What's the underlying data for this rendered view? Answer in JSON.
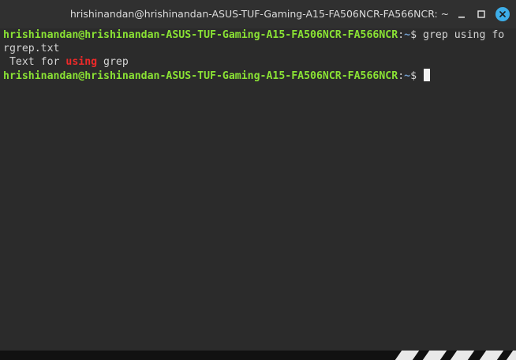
{
  "window": {
    "title": "hrishinandan@hrishinandan-ASUS-TUF-Gaming-A15-FA506NCR-FA566NCR: ~"
  },
  "terminal": {
    "line1": {
      "user_host": "hrishinandan@hrishinandan-ASUS-TUF-Gaming-A15-FA506NCR-FA566NCR",
      "sep": ":",
      "path": "~",
      "sym": "$ ",
      "cmd_part1": "grep using fo"
    },
    "line2": {
      "cmd_part2": "rgrep.txt"
    },
    "line3": {
      "pre": " Text for ",
      "match": "using",
      "post": " grep"
    },
    "line4": {
      "user_host": "hrishinandan@hrishinandan-ASUS-TUF-Gaming-A15-FA506NCR-FA566NCR",
      "sep": ":",
      "path": "~",
      "sym": "$ "
    }
  },
  "colors": {
    "background": "#2b2b2b",
    "prompt_user": "#8ae234",
    "prompt_path": "#729fcf",
    "match": "#ef2929",
    "close_button": "#3daee9"
  },
  "icons": [
    "minimize-icon",
    "maximize-icon",
    "close-icon"
  ]
}
